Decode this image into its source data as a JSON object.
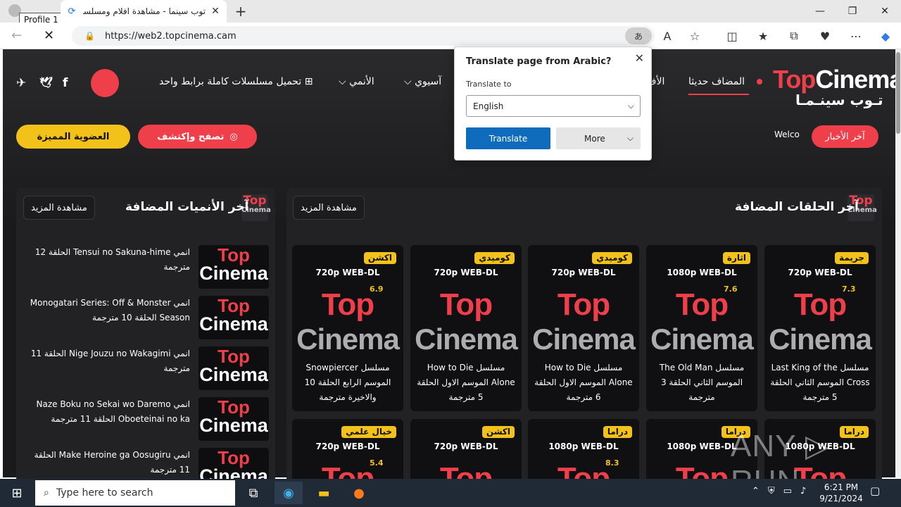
{
  "browser": {
    "profile_label": "Profile 1",
    "tab_title": "توب سينما - مشاهدة افلام ومسلسلات",
    "tab_close": "✕",
    "new_tab": "+",
    "url": "https://web2.topcinema.cam",
    "translate_icon": "あ",
    "window_controls": [
      "—",
      "❐",
      "✕"
    ]
  },
  "site": {
    "logo_top_red": "Top",
    "logo_top_white": "Cinema",
    "logo_sub": "تـوب سينـمـا",
    "nav": [
      "المضاف حديثا",
      "الأف",
      "آسيوي",
      "الأنمي",
      "تحميل مسلسلات كاملة برابط واحد"
    ],
    "nav_chevron": "⌵",
    "membership_btn": "العضوية المميزة",
    "browse_btn": "تصفح وإكتشف",
    "news_btn": "آخر الأخبار",
    "ticker": "Welco",
    "social": [
      "✈",
      "🐦",
      "f"
    ]
  },
  "sections": {
    "episodes_title": "آخر الحلقات المضافة",
    "anime_title": "آخر الأنميات المضافة",
    "more": "مشاهدة المزيد",
    "mini_logo_a": "Top",
    "mini_logo_b": "Cinema"
  },
  "cards": [
    {
      "genre": "جريمة",
      "quality": "720p WEB-DL",
      "rating": "7.3",
      "title": "مسلسل Last King of the Cross الموسم الثاني الحلقة 5 مترجمة"
    },
    {
      "genre": "اثارة",
      "quality": "1080p WEB-DL",
      "rating": "7.6",
      "title": "مسلسل The Old Man الموسم الثاني الحلقة 3 مترجمة"
    },
    {
      "genre": "كوميدي",
      "quality": "720p WEB-DL",
      "rating": "",
      "title": "مسلسل How to Die Alone الموسم الاول الحلقة 6 مترجمة"
    },
    {
      "genre": "كوميدي",
      "quality": "720p WEB-DL",
      "rating": "",
      "title": "مسلسل How to Die Alone الموسم الاول الحلقة 5 مترجمة"
    },
    {
      "genre": "اكشن",
      "quality": "720p WEB-DL",
      "rating": "6.9",
      "title": "مسلسل Snowpiercer الموسم الرابع الحلقة 10 والاخيرة مترجمة"
    },
    {
      "genre": "دراما",
      "quality": "1080p WEB-DL",
      "rating": "",
      "title": ""
    },
    {
      "genre": "دراما",
      "quality": "1080p WEB-DL",
      "rating": "",
      "title": ""
    },
    {
      "genre": "دراما",
      "quality": "1080p WEB-DL",
      "rating": "8.3",
      "title": ""
    },
    {
      "genre": "اكشن",
      "quality": "720p WEB-DL",
      "rating": "",
      "title": ""
    },
    {
      "genre": "خيال علمي",
      "quality": "720p WEB-DL",
      "rating": "5.4",
      "title": ""
    }
  ],
  "card_logo_a": "Top",
  "card_logo_b": "Cinema",
  "anime": [
    "انمي Tensui no Sakuna-hime الحلقة 12 مترجمة",
    "انمي Monogatari Series: Off & Monster Season الحلقة 10 مترجمة",
    "انمي Nige Jouzu no Wakagimi الحلقة 11 مترجمة",
    "انمي Naze Boku no Sekai wo Daremo Oboeteinai no ka الحلقة 11 مترجمة",
    "انمي Make Heroine ga Oosugiru الحلقة 11 مترجمة"
  ],
  "translate_popup": {
    "title": "Translate page from Arabic?",
    "close": "✕",
    "label": "Translate to",
    "language": "English",
    "translate_btn": "Translate",
    "more_btn": "More"
  },
  "watermark": "ANY ▷ RUN",
  "taskbar": {
    "search_placeholder": "Type here to search",
    "time": "6:21 PM",
    "date": "9/21/2024"
  }
}
